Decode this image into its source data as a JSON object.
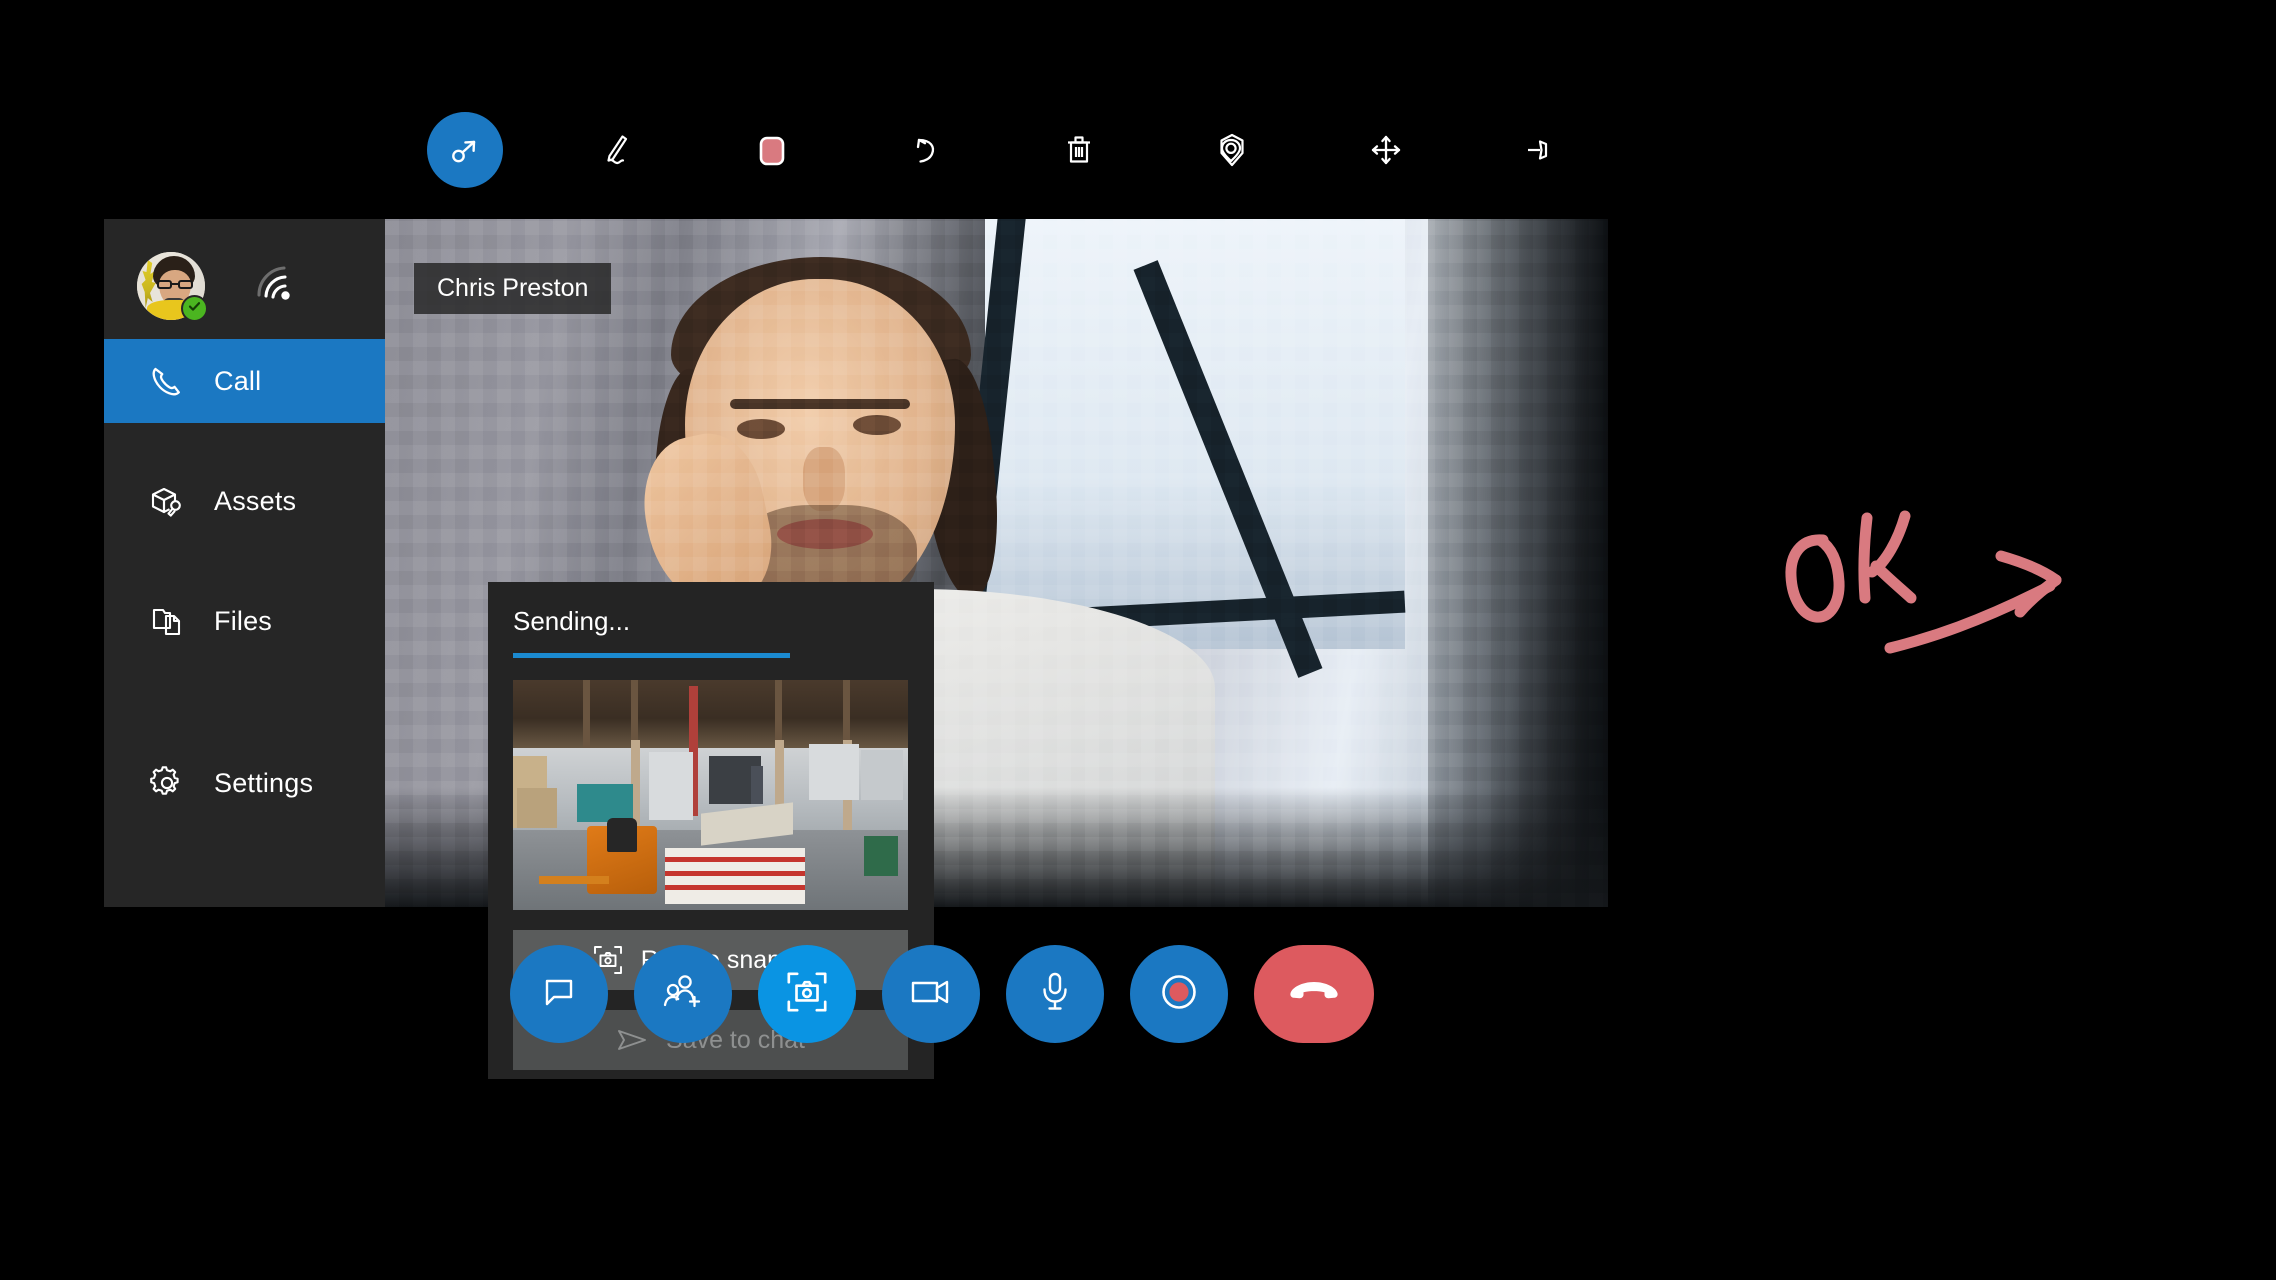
{
  "app": {
    "accent_blue": "#1b78c2",
    "highlight_blue": "#0a94e3",
    "panel_bg": "#242424",
    "sidebar_bg": "#262626",
    "ink_color": "#d97a80",
    "status_green": "#4bb520",
    "end_call_red": "#dd5a5f"
  },
  "annotation_toolbar": {
    "tools": [
      {
        "name": "select-tool",
        "label": "Select",
        "icon": "cursor-select-icon",
        "active": true
      },
      {
        "name": "pen-tool",
        "label": "Draw",
        "icon": "pen-icon",
        "active": false
      },
      {
        "name": "color-tool",
        "label": "Color",
        "icon": "color-swatch-icon",
        "active": false,
        "swatch": "#d97a80"
      },
      {
        "name": "undo-tool",
        "label": "Undo",
        "icon": "undo-icon",
        "active": false
      },
      {
        "name": "delete-tool",
        "label": "Delete all",
        "icon": "trash-icon",
        "active": false
      },
      {
        "name": "anchor-tool",
        "label": "Place marker",
        "icon": "location-pin-icon",
        "active": false
      },
      {
        "name": "move-tool",
        "label": "Move",
        "icon": "move-arrows-icon",
        "active": false
      },
      {
        "name": "pin-tool",
        "label": "Pin toolbar",
        "icon": "pushpin-icon",
        "active": false
      }
    ]
  },
  "sidebar": {
    "user": {
      "avatar_name": "user-avatar",
      "presence": "available",
      "presence_icon": "check-badge-icon",
      "signal_icon": "signal-strength-icon"
    },
    "items": [
      {
        "label": "Call",
        "icon": "phone-icon",
        "selected": true
      },
      {
        "label": "Assets",
        "icon": "assets-box-icon",
        "selected": false
      },
      {
        "label": "Files",
        "icon": "files-icon",
        "selected": false
      },
      {
        "label": "Settings",
        "icon": "gear-icon",
        "selected": false
      }
    ]
  },
  "video": {
    "participant_name": "Chris Preston"
  },
  "snapshot_panel": {
    "status_label": "Sending...",
    "progress_percent": 70,
    "thumbnail_name": "snapshot-thumbnail",
    "retake_label": "Retake snapshot",
    "retake_icon": "camera-frame-icon",
    "save_label": "Save to chat",
    "save_icon": "send-arrow-icon",
    "save_disabled": true
  },
  "call_controls": [
    {
      "name": "chat-button",
      "label": "Chat",
      "icon": "chat-bubble-icon",
      "style": "normal"
    },
    {
      "name": "add-people-button",
      "label": "Add people",
      "icon": "add-person-icon",
      "style": "normal"
    },
    {
      "name": "snapshot-button",
      "label": "Take snapshot",
      "icon": "camera-frame-icon",
      "style": "highlight"
    },
    {
      "name": "video-button",
      "label": "Video",
      "icon": "video-camera-icon",
      "style": "normal"
    },
    {
      "name": "mic-button",
      "label": "Microphone",
      "icon": "microphone-icon",
      "style": "normal"
    },
    {
      "name": "record-button",
      "label": "Record",
      "icon": "record-dot-icon",
      "style": "normal"
    },
    {
      "name": "end-call-button",
      "label": "End call",
      "icon": "hang-up-phone-icon",
      "style": "end"
    }
  ],
  "ink_annotation": {
    "text": "OK",
    "shape": "ok-arrow-ink",
    "color": "#d97a80"
  }
}
